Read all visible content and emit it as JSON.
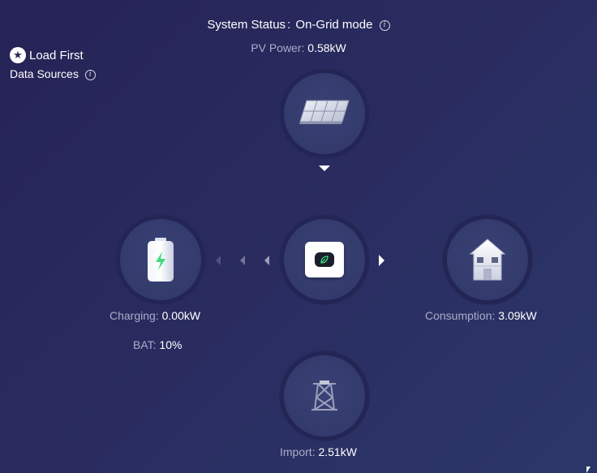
{
  "header": {
    "system_status_label": "System Status",
    "system_status_value": "On-Grid mode",
    "pv_power_label": "PV Power",
    "pv_power_value": "0.58kW",
    "separator": ":"
  },
  "left_panel": {
    "load_first_label": "Load First",
    "data_sources_label": "Data Sources"
  },
  "nodes": {
    "solar": {
      "icon": "solar-panel-icon"
    },
    "inverter": {
      "icon": "inverter-icon"
    },
    "battery": {
      "icon": "battery-icon",
      "charging_label": "Charging",
      "charging_value": "0.00kW",
      "bat_label": "BAT",
      "bat_value": "10%",
      "level_fraction": 0.1
    },
    "consumption": {
      "icon": "house-icon",
      "label": "Consumption",
      "value": "3.09kW"
    },
    "grid": {
      "icon": "power-tower-icon",
      "label": "Import",
      "value": "2.51kW"
    }
  },
  "colors": {
    "background_start": "#262356",
    "background_end": "#2c3769",
    "node_ring": "#232655",
    "node_fill": "#363d70",
    "muted_text": "#a9adc8",
    "accent_green": "#3ddc84"
  }
}
